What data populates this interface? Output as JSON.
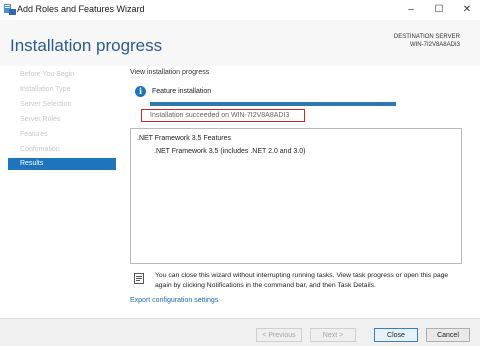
{
  "window": {
    "title": "Add Roles and Features Wizard",
    "minimize_glyph": "–",
    "maximize_glyph": "☐",
    "close_glyph": "✕"
  },
  "header": {
    "heading": "Installation progress",
    "destination_label": "DESTINATION SERVER",
    "destination_server": "WIN-7I2V8A8ADI3"
  },
  "nav": {
    "items": [
      {
        "label": "Before You Begin",
        "active": false
      },
      {
        "label": "Installation Type",
        "active": false
      },
      {
        "label": "Server Selection",
        "active": false
      },
      {
        "label": "Server Roles",
        "active": false
      },
      {
        "label": "Features",
        "active": false
      },
      {
        "label": "Confirmation",
        "active": false
      },
      {
        "label": "Results",
        "active": true
      }
    ]
  },
  "main": {
    "view_label": "View installation progress",
    "info_glyph": "i",
    "feature_label": "Feature installation",
    "progress_fraction": 1.0,
    "success_text": "Installation succeeded on WIN-7I2V8A8ADI3",
    "results": [
      ".NET Framework 3.5 Features",
      ".NET Framework 3.5 (includes .NET 2.0 and 3.0)"
    ],
    "note": "You can close this wizard without interrupting running tasks. View task progress or open this page again by clicking Notifications in the command bar, and then Task Details.",
    "export_link": "Export configuration settings"
  },
  "footer": {
    "previous": "< Previous",
    "next": "Next >",
    "close": "Close",
    "cancel": "Cancel"
  },
  "colors": {
    "accent": "#1e75bd",
    "heading": "#2a5b8f",
    "highlight_border": "#c42a2a",
    "link": "#1e6bb8"
  }
}
